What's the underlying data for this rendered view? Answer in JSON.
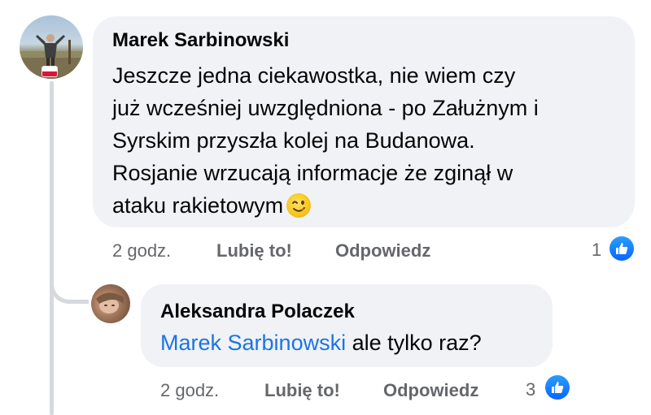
{
  "comment": {
    "author": "Marek Sarbinowski",
    "text_lines": [
      "Jeszcze jedna ciekawostka, nie wiem czy",
      "już wcześniej uwzględniona - po Załużnym i",
      "Syrskim przyszła kolej na Budanowa.",
      "Rosjanie wrzucają informacje że zginął w",
      "ataku rakietowym"
    ],
    "emoji": "winking-face",
    "time": "2 godz.",
    "like_label": "Lubię to!",
    "reply_label": "Odpowiedz",
    "reaction_count": "1",
    "avatar_flag": "poland-flag"
  },
  "reply": {
    "author": "Aleksandra Polaczek",
    "mention": "Marek Sarbinowski",
    "text": " ale tylko raz?",
    "time": "2 godz.",
    "like_label": "Lubię to!",
    "reply_label": "Odpowiedz",
    "reaction_count": "3"
  },
  "colors": {
    "bubble": "#f0f2f5",
    "meta_text": "#65676b",
    "mention": "#1b74e4",
    "like_blue": "#0866ff"
  }
}
